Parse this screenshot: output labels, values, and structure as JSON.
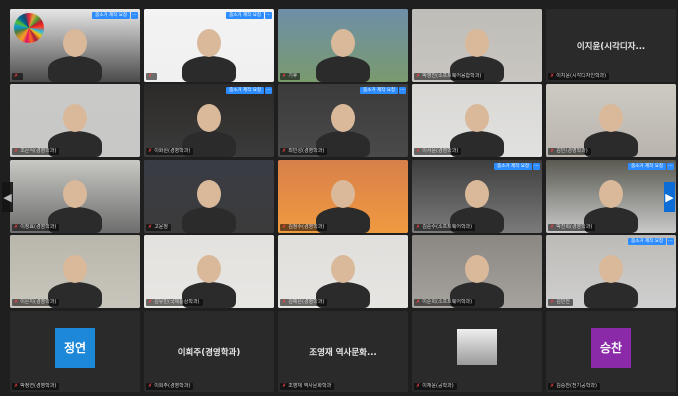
{
  "badge_text": "줌소거 제작 요청",
  "tiles": [
    {
      "id": "t00",
      "name": "",
      "cx": "#4a4a4a",
      "bg": "#e6e6e6",
      "active": true,
      "badge": true,
      "logo": "Xi노 SDG 교육"
    },
    {
      "id": "t01",
      "name": "",
      "cx": "#f0f0f0",
      "bg": "#f3f3f3",
      "active": false,
      "badge": true
    },
    {
      "id": "t02",
      "name": "기후",
      "cx": "#7a9a6e",
      "bg": "#6e8fa8",
      "active": false,
      "badge": false
    },
    {
      "id": "t03",
      "name": "박영진(소프트웨어융합학과)",
      "cx": "#c9c6c1",
      "bg": "#bfbdb8",
      "active": false,
      "badge": false
    },
    {
      "id": "t04",
      "name": "이지윤(시각디자인학과)",
      "center": "이지윤(시각디자...",
      "active": false,
      "badge": false
    },
    {
      "id": "t10",
      "name": "조은식(경영학과)",
      "cx": "#c8c8c6",
      "bg": "#c9c9c7",
      "active": false,
      "badge": false
    },
    {
      "id": "t11",
      "name": "이화원(경영학과)",
      "cx": "#3b3b3b",
      "bg": "#2c2a28",
      "active": false,
      "badge": true
    },
    {
      "id": "t12",
      "name": "최민성(경영학과)",
      "cx": "#4a4a4a",
      "bg": "#3b3b3b",
      "active": false,
      "badge": true
    },
    {
      "id": "t13",
      "name": "이서윤(경영학과)",
      "cx": "#e1e1df",
      "bg": "#d9d8d5",
      "active": false,
      "badge": false
    },
    {
      "id": "t14",
      "name": "김민(경영학과)",
      "cx": "#b9b4ad",
      "bg": "#cdcac4",
      "active": false,
      "badge": false
    },
    {
      "id": "t20",
      "name": "이정효(경영학과)",
      "cx": "#6d6d6d",
      "bg": "#c8c8c4",
      "active": false,
      "badge": false
    },
    {
      "id": "t21",
      "name": "고윤정",
      "cx": "#3b3b3b",
      "bg": "#3a3c45",
      "active": false,
      "badge": false
    },
    {
      "id": "t22",
      "name": "김정수(경영학과)",
      "cx": "#f09a40",
      "bg": "#d8804a",
      "active": false,
      "badge": false
    },
    {
      "id": "t23",
      "name": "김준수(소프트웨어학과)",
      "cx": "#7b7b7b",
      "bg": "#3f3f3f",
      "active": false,
      "badge": true
    },
    {
      "id": "t24",
      "name": "박진희(경영학과)",
      "cx": "#c9c9c9",
      "bg": "#5a5a52",
      "active": false,
      "badge": true
    },
    {
      "id": "t30",
      "name": "이은지(경영학과)",
      "cx": "#c8c5bc",
      "bg": "#b9b7ac",
      "active": false,
      "badge": false
    },
    {
      "id": "t31",
      "name": "김유빈(국제통상학과)",
      "cx": "#e8e6e3",
      "bg": "#e4e2df",
      "active": false,
      "badge": false
    },
    {
      "id": "t32",
      "name": "김예은(경영학과)",
      "cx": "#e7e5e2",
      "bg": "#e1dfdc",
      "active": false,
      "badge": false
    },
    {
      "id": "t33",
      "name": "이준희(소프트웨어학과)",
      "cx": "#a6a39e",
      "bg": "#8b8782",
      "active": false,
      "badge": false
    },
    {
      "id": "t34",
      "name": "김민찬",
      "cx": "#cfcfcf",
      "bg": "#bdbbb7",
      "active": false,
      "badge": true
    },
    {
      "id": "t40",
      "name": "박정연(경영학과)",
      "avatar": "정연",
      "avatar_color": "#1e88d8",
      "active": false,
      "badge": false
    },
    {
      "id": "t41",
      "name": "이희주(경영학과)",
      "center": "이희주(경영학과)",
      "active": false,
      "badge": false
    },
    {
      "id": "t42",
      "name": "조영재 역사문화학과",
      "center": "조영재 역사문화...",
      "active": false,
      "badge": false
    },
    {
      "id": "t43",
      "name": "이재윤(공학과)",
      "picture": true,
      "active": false,
      "badge": false
    },
    {
      "id": "t44",
      "name": "김승찬(전기공학과)",
      "avatar": "승찬",
      "avatar_color": "#8a2aa8",
      "active": false,
      "badge": false
    }
  ],
  "nav": {
    "prev": "◀",
    "next": "▶"
  }
}
